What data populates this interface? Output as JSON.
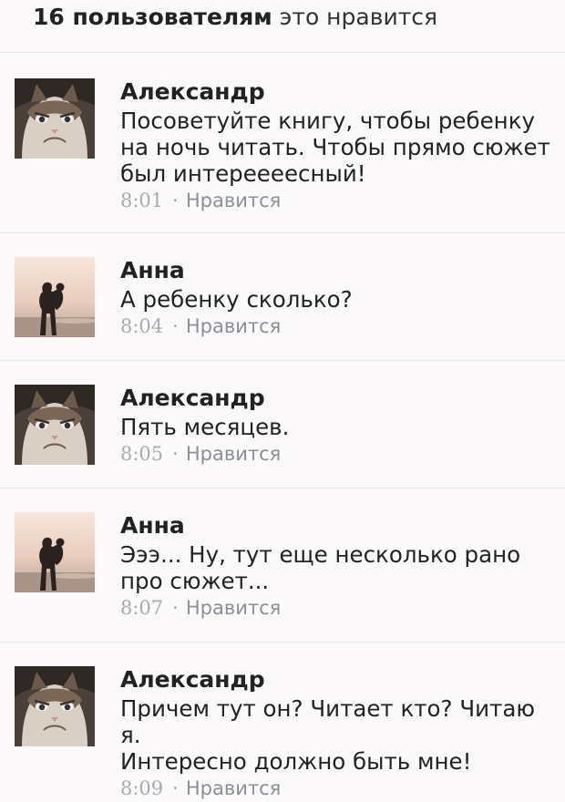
{
  "likes_header": {
    "count_text": "16 пользователям",
    "suffix": "это нравится"
  },
  "comments": [
    {
      "author": "Александр",
      "avatar": "cat",
      "text": "Посоветуйте книгу, чтобы ребенку\nна ночь читать. Чтобы прямо сюжет\nбыл интереееесный!",
      "time": "8:01",
      "like_label": "Нравится"
    },
    {
      "author": "Анна",
      "avatar": "couple",
      "text": "А ребенку сколько?",
      "time": "8:04",
      "like_label": "Нравится"
    },
    {
      "author": "Александр",
      "avatar": "cat",
      "text": "Пять месяцев.",
      "time": "8:05",
      "like_label": "Нравится"
    },
    {
      "author": "Анна",
      "avatar": "couple",
      "text": "Эээ... Ну, тут еще несколько рано\nпро сюжет...",
      "time": "8:07",
      "like_label": "Нравится"
    },
    {
      "author": "Александр",
      "avatar": "cat",
      "text": "Причем тут он? Читает кто? Читаю я.\nИнтересно должно быть мне!",
      "time": "8:09",
      "like_label": "Нравится"
    }
  ],
  "meta_separator": "·"
}
